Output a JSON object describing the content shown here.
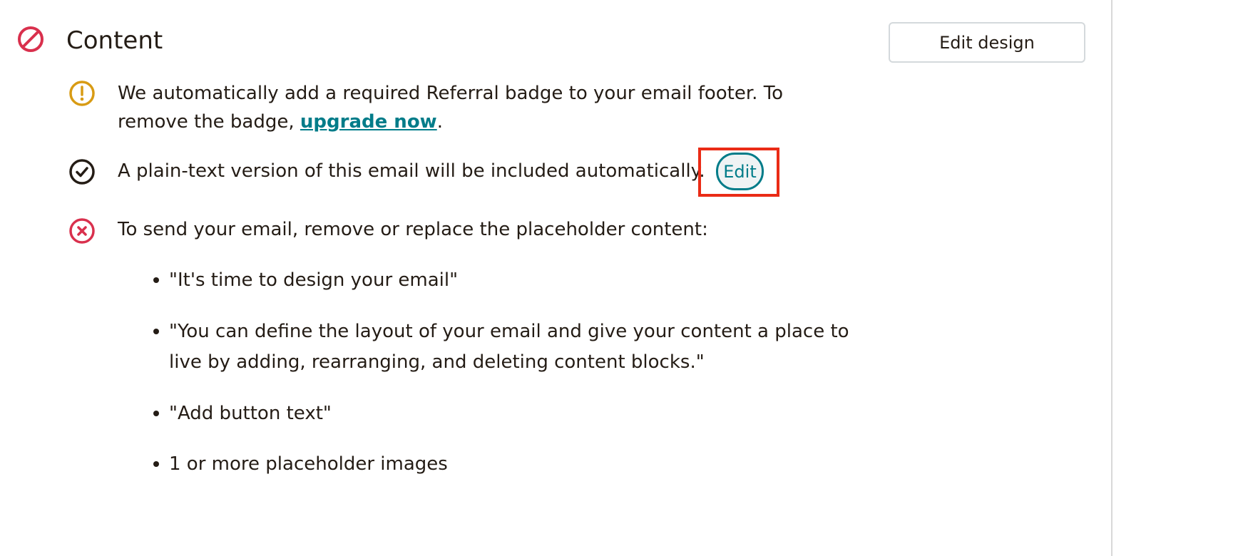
{
  "section": {
    "title": "Content",
    "status_icon": "prohibited-icon",
    "edit_design_label": "Edit design"
  },
  "checks": {
    "referral": {
      "icon": "warning-icon",
      "text_before": "We automatically add a required Referral badge to your email footer. To",
      "text_line2": "remove the badge, ",
      "link_label": "upgrade now",
      "text_after": "."
    },
    "plain_text": {
      "icon": "checkmark-icon",
      "text": "A plain-text version of this email will be included automatically.",
      "edit_label": "Edit"
    },
    "placeholder": {
      "icon": "error-icon",
      "text": "To send your email, remove or replace the placeholder content:",
      "items": [
        "\"It's time to design your email\"",
        "\"You can define the layout of your email and give your content a place to live by adding, rearranging, and deleting content blocks.\"",
        "\"Add button text\"",
        "1 or more placeholder images"
      ]
    }
  },
  "colors": {
    "error": "#d9304d",
    "warning": "#d89b14",
    "success": "#241c15",
    "link": "#007c89",
    "highlight": "#ea2b16"
  }
}
